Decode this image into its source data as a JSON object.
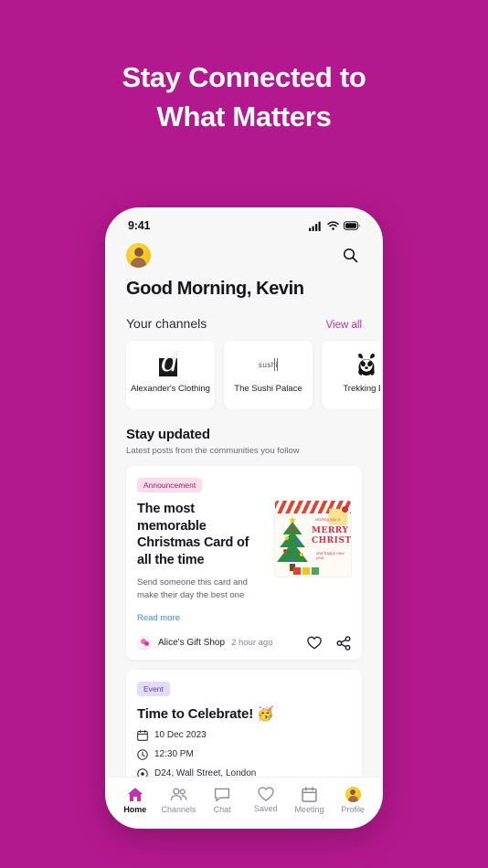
{
  "hero": {
    "line1": "Stay Connected to",
    "line2": "What Matters"
  },
  "colors": {
    "background": "#B4188E",
    "accent": "#C32FAF",
    "link": "#3B8DF0",
    "badge_announcement_bg": "#FBDCEC",
    "badge_announcement_text": "#8E2C62",
    "badge_event_bg": "#E2DCFA",
    "badge_event_text": "#5B41B8"
  },
  "status_bar": {
    "time": "9:41",
    "icons": [
      "signal-icon",
      "wifi-icon",
      "battery-icon"
    ]
  },
  "app_header": {
    "avatar": "user-avatar",
    "search": "search-icon"
  },
  "greeting": "Good Morning, Kevin",
  "channels_section": {
    "title": "Your channels",
    "view_all": "View all",
    "items": [
      {
        "name": "Alexander's Clothing",
        "logo": "alexander-d-logo"
      },
      {
        "name": "The Sushi Palace",
        "logo": "sushi-logo"
      },
      {
        "name": "Trekking Be",
        "logo": "panda-logo"
      }
    ]
  },
  "updated_section": {
    "title": "Stay updated",
    "subtitle": "Latest posts from the communities you follow"
  },
  "posts": [
    {
      "badge": "Announcement",
      "badge_type": "announcement",
      "title": "The most memorable Christmas Card of all the time",
      "description": "Send someone this card and make their day the best one",
      "read_more": "Read more",
      "author": "Alice's Gift Shop",
      "time": "2 hour ago",
      "actions": [
        "heart-icon",
        "share-icon"
      ],
      "thumbnail": {
        "type": "christmas-card",
        "text_top": "wishing you a",
        "text_main_1": "MERRY",
        "text_main_2": "CHRISTMAS",
        "text_bottom": "and happy new year"
      }
    },
    {
      "badge": "Event",
      "badge_type": "event",
      "title": "Time to Celebrate! 🥳",
      "details": [
        {
          "icon": "calendar-icon",
          "text": "10 Dec 2023"
        },
        {
          "icon": "clock-icon",
          "text": "12:30 PM"
        },
        {
          "icon": "location-pin-icon",
          "text": "D24, Wall Street, London"
        }
      ]
    }
  ],
  "bottom_nav": {
    "items": [
      {
        "label": "Home",
        "icon": "home-icon",
        "active": true
      },
      {
        "label": "Channels",
        "icon": "people-icon",
        "active": false
      },
      {
        "label": "Chat",
        "icon": "chat-bubble-icon",
        "active": false
      },
      {
        "label": "Saved",
        "icon": "heart-icon",
        "active": false
      },
      {
        "label": "Meeting",
        "icon": "calendar-icon",
        "active": false
      },
      {
        "label": "Profile",
        "icon": "profile-avatar-icon",
        "active": false
      }
    ]
  }
}
